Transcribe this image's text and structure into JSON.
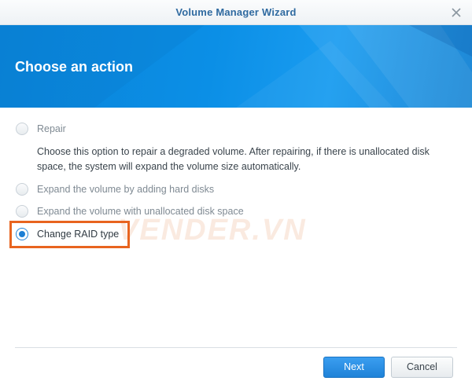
{
  "window": {
    "title": "Volume Manager Wizard",
    "close_icon": "close-icon"
  },
  "banner": {
    "heading": "Choose an action",
    "color": "#0b8fe6"
  },
  "options": [
    {
      "label": "Repair",
      "selected": false
    },
    {
      "label": "Expand the volume by adding hard disks",
      "selected": false
    },
    {
      "label": "Expand the volume with unallocated disk space",
      "selected": false
    },
    {
      "label": "Change RAID type",
      "selected": true
    }
  ],
  "repair_description": "Choose this option to repair a degraded volume. After repairing, if there is unallocated disk space, the system will expand the volume size automatically.",
  "watermark": "VENDER.VN",
  "buttons": {
    "next": "Next",
    "cancel": "Cancel"
  },
  "colors": {
    "highlight": "#e8641f",
    "accent": "#1c7fd4"
  }
}
